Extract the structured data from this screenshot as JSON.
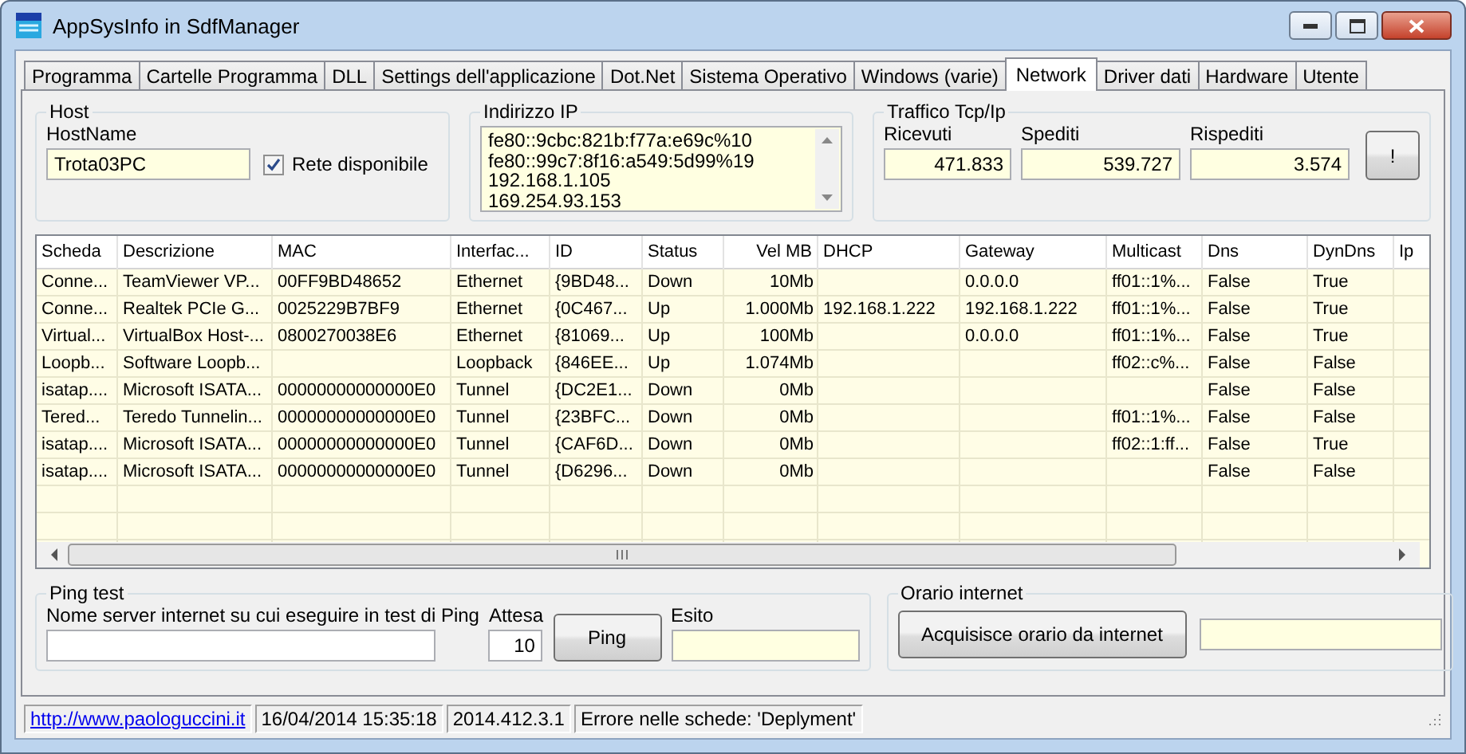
{
  "window": {
    "title": "AppSysInfo in SdfManager"
  },
  "tabs": [
    {
      "label": "Programma",
      "selected": false
    },
    {
      "label": "Cartelle Programma",
      "selected": false
    },
    {
      "label": "DLL",
      "selected": false
    },
    {
      "label": "Settings dell'applicazione",
      "selected": false
    },
    {
      "label": "Dot.Net",
      "selected": false
    },
    {
      "label": "Sistema Operativo",
      "selected": false
    },
    {
      "label": "Windows (varie)",
      "selected": false
    },
    {
      "label": "Network",
      "selected": true
    },
    {
      "label": "Driver dati",
      "selected": false
    },
    {
      "label": "Hardware",
      "selected": false
    },
    {
      "label": "Utente",
      "selected": false
    }
  ],
  "host": {
    "title": "Host",
    "hostname_label": "HostName",
    "hostname": "Trota03PC",
    "network_checkbox": {
      "label": "Rete disponibile",
      "checked": true
    }
  },
  "ip": {
    "title": "Indirizzo IP",
    "lines": [
      "fe80::9cbc:821b:f77a:e69c%10",
      "fe80::99c7:8f16:a549:5d99%19",
      "192.168.1.105",
      "169.254.93.153"
    ]
  },
  "traffic": {
    "title": "Traffico Tcp/Ip",
    "fields": [
      {
        "label": "Ricevuti",
        "value": "471.833"
      },
      {
        "label": "Spediti",
        "value": "539.727"
      },
      {
        "label": "Rispediti",
        "value": "3.574"
      }
    ],
    "button": "!"
  },
  "table": {
    "columns": [
      "Scheda",
      "Descrizione",
      "MAC",
      "Interfac...",
      "ID",
      "Status",
      "Vel MB",
      "DHCP",
      "Gateway",
      "Multicast",
      "Dns",
      "DynDns",
      "Ip"
    ],
    "rows": [
      [
        "Conne...",
        "TeamViewer VP...",
        "00FF9BD48652",
        "Ethernet",
        "{9BD48...",
        "Down",
        "10Mb",
        "",
        "0.0.0.0",
        "ff01::1%...",
        "False",
        "True",
        ""
      ],
      [
        "Conne...",
        "Realtek PCIe G...",
        "0025229B7BF9",
        "Ethernet",
        "{0C467...",
        "Up",
        "1.000Mb",
        "192.168.1.222",
        "192.168.1.222",
        "ff01::1%...",
        "False",
        "True",
        ""
      ],
      [
        "Virtual...",
        "VirtualBox Host-...",
        "0800270038E6",
        "Ethernet",
        "{81069...",
        "Up",
        "100Mb",
        "",
        "0.0.0.0",
        "ff01::1%...",
        "False",
        "True",
        ""
      ],
      [
        "Loopb...",
        "Software Loopb...",
        "",
        "Loopback",
        "{846EE...",
        "Up",
        "1.074Mb",
        "",
        "",
        "ff02::c%...",
        "False",
        "False",
        ""
      ],
      [
        "isatap....",
        "Microsoft ISATA...",
        "00000000000000E0",
        "Tunnel",
        "{DC2E1...",
        "Down",
        "0Mb",
        "",
        "",
        "",
        "False",
        "False",
        ""
      ],
      [
        "Tered...",
        "Teredo Tunnelin...",
        "00000000000000E0",
        "Tunnel",
        "{23BFC...",
        "Down",
        "0Mb",
        "",
        "",
        "ff01::1%...",
        "False",
        "False",
        ""
      ],
      [
        "isatap....",
        "Microsoft ISATA...",
        "00000000000000E0",
        "Tunnel",
        "{CAF6D...",
        "Down",
        "0Mb",
        "",
        "",
        "ff02::1:ff...",
        "False",
        "True",
        ""
      ],
      [
        "isatap....",
        "Microsoft ISATA...",
        "00000000000000E0",
        "Tunnel",
        "{D6296...",
        "Down",
        "0Mb",
        "",
        "",
        "",
        "False",
        "False",
        ""
      ]
    ]
  },
  "ping": {
    "title": "Ping test",
    "server_label": "Nome server internet su cui eseguire in test di Ping",
    "wait_label": "Attesa",
    "wait_value": "10",
    "button": "Ping",
    "result_label": "Esito"
  },
  "time": {
    "title": "Orario internet",
    "button": "Acquisisce orario da internet"
  },
  "status_bar": [
    {
      "kind": "link",
      "text": "http://www.paologuccini.it"
    },
    {
      "kind": "text",
      "text": "16/04/2014 15:35:18"
    },
    {
      "kind": "text",
      "text": "2014.412.3.1"
    },
    {
      "kind": "text",
      "text": "Errore nelle schede: 'Deplyment'"
    }
  ]
}
